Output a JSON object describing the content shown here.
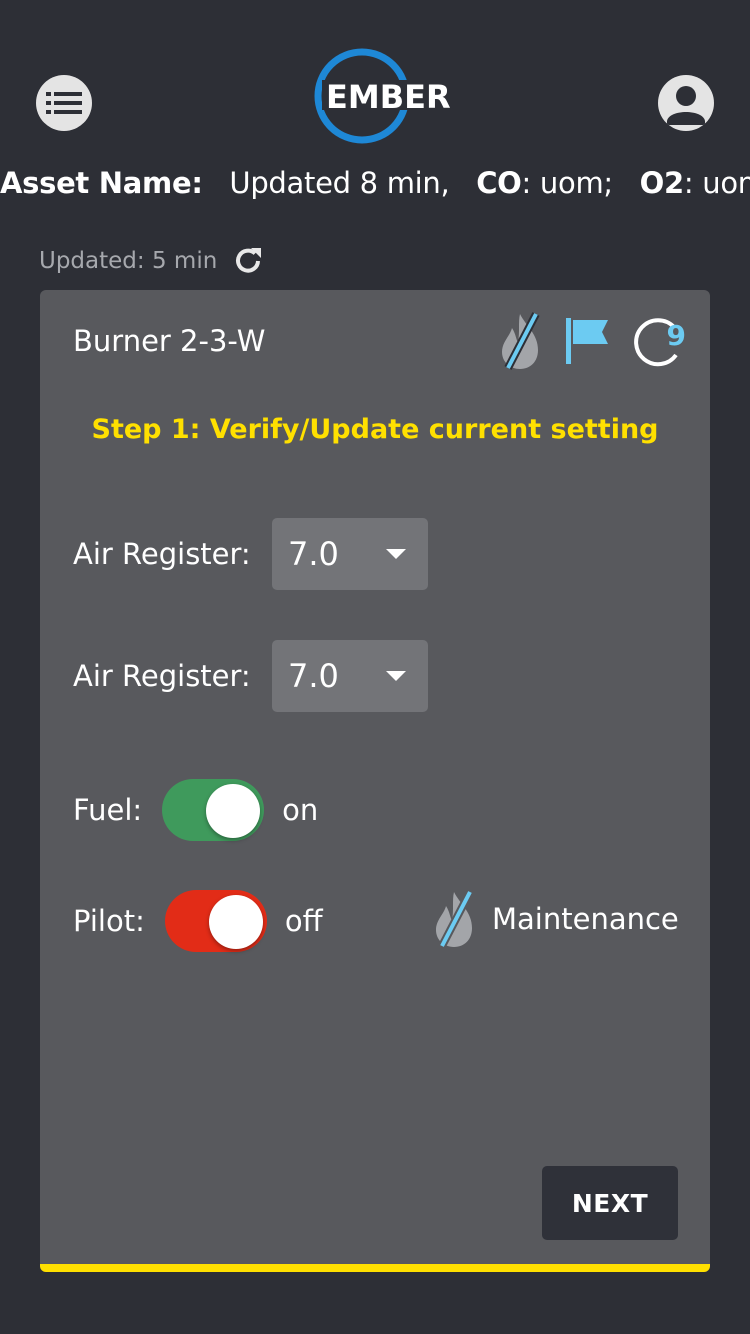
{
  "header": {
    "logo_text": "EMBER",
    "asset_name_label": "Asset Name:",
    "asset_updated": "Updated 8 min,",
    "co_label": "CO",
    "co_value": ": uom;",
    "o2_label": "O2",
    "o2_value": ": uom;"
  },
  "updated": {
    "label": "Updated:",
    "value": "5 min"
  },
  "card": {
    "burner_name": "Burner 2-3-W",
    "cycle_count": "9",
    "step_title": "Step 1: Verify/Update current setting",
    "fields": [
      {
        "label": "Air Register:",
        "value": "7.0"
      },
      {
        "label": "Air Register:",
        "value": "7.0"
      }
    ],
    "fuel": {
      "label": "Fuel:",
      "state": "on"
    },
    "pilot": {
      "label": "Pilot:",
      "state": "off"
    },
    "maintenance_label": "Maintenance",
    "next_label": "NEXT"
  },
  "colors": {
    "background": "#2d2f36",
    "card": "#58595d",
    "accent_yellow": "#ffe000",
    "accent_blue": "#6ccbf2",
    "logo_blue": "#1e88d6",
    "toggle_on": "#3f9a5c",
    "toggle_off": "#e22c17"
  },
  "icons": [
    "list-icon",
    "user-icon",
    "refresh-icon",
    "flame-off-icon",
    "flag-icon",
    "cycle-icon"
  ]
}
